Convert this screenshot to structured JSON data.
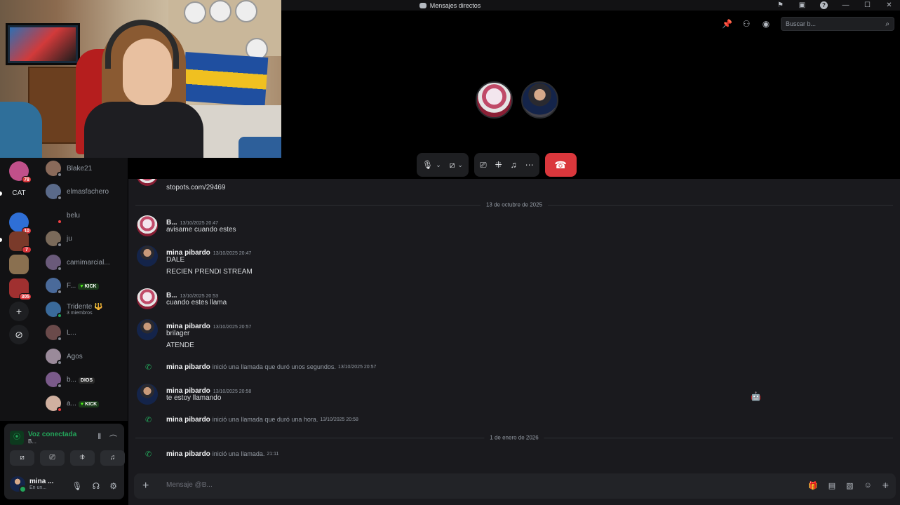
{
  "window": {
    "title": "Mensajes directos"
  },
  "call": {
    "search_placeholder": "Buscar b..."
  },
  "rail": {
    "items": [
      {
        "badge": "78"
      },
      {
        "label": "CAT"
      },
      {
        "badge": "10"
      },
      {
        "badge": "7"
      },
      {
        "badge": ""
      },
      {
        "badge": "305"
      }
    ]
  },
  "dms": [
    {
      "name": "Blake21",
      "status": "off"
    },
    {
      "name": "elmasfachero",
      "status": "off"
    },
    {
      "name": "belu",
      "status": "dnd"
    },
    {
      "name": "ju",
      "status": "off"
    },
    {
      "name": "camimarcial...",
      "status": "off"
    },
    {
      "name": "F...",
      "tag": "KICK",
      "status": "off"
    },
    {
      "name": "Tridente 🔱",
      "sub": "3 miembros",
      "status": "on"
    },
    {
      "name": "L...",
      "status": "off"
    },
    {
      "name": "Agos",
      "status": "off"
    },
    {
      "name": "b...",
      "tag": "DIOS",
      "status": "off"
    },
    {
      "name": "a...",
      "tag": "KICK",
      "status": "dnd"
    }
  ],
  "voice": {
    "title": "Voz conectada",
    "sub": "B...",
    "user_name": "mina ...",
    "user_status": "En un..."
  },
  "chat": {
    "top_link": "stopots.com/29469",
    "divider_1": "13 de octubre de 2025",
    "divider_2": "1 de enero de 2026",
    "messages": [
      {
        "author": "B...",
        "time": "13/10/2025 20:47",
        "lines": [
          "avisame cuando estes"
        ]
      },
      {
        "author": "mina pibardo",
        "time": "13/10/2025 20:47",
        "lines": [
          "DALE",
          "RECIEN PRENDI STREAM"
        ]
      },
      {
        "author": "B...",
        "time": "13/10/2025 20:53",
        "lines": [
          "cuando estes llama"
        ]
      },
      {
        "author": "mina pibardo",
        "time": "13/10/2025 20:57",
        "lines": [
          "brilager",
          "ATENDE"
        ]
      },
      {
        "author": "mina pibardo",
        "time": "13/10/2025 20:58",
        "lines": [
          "te estoy llamando"
        ]
      }
    ],
    "system": [
      {
        "author": "mina pibardo",
        "text": "inició una llamada que duró unos segundos.",
        "time": "13/10/2025 20:57"
      },
      {
        "author": "mina pibardo",
        "text": "inició una llamada que duró una hora.",
        "time": "13/10/2025 20:58"
      },
      {
        "author": "mina pibardo",
        "text": "inició una llamada.",
        "time": "21:11"
      }
    ],
    "composer_placeholder": "Mensaje @B..."
  }
}
